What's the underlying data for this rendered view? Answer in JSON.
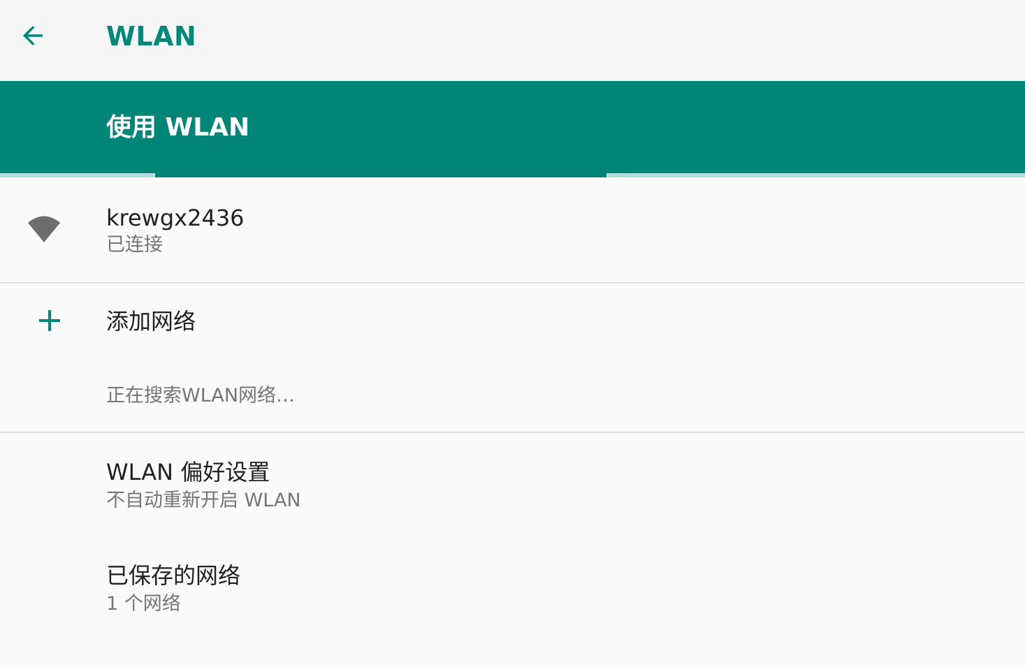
{
  "app_bar": {
    "back_icon": "arrow-back-icon",
    "title": "WLAN"
  },
  "wifi_switch": {
    "label": "使用 WLAN",
    "enabled": true,
    "scanning": true
  },
  "connected_network": {
    "icon": "wifi-signal-icon",
    "ssid": "krewgx2436",
    "status": "已连接"
  },
  "add_network": {
    "icon": "plus-icon",
    "label": "添加网络"
  },
  "scan_status": "正在搜索WLAN网络…",
  "preferences": {
    "title": "WLAN 偏好设置",
    "summary": "不自动重新开启 WLAN"
  },
  "saved_networks": {
    "title": "已保存的网络",
    "summary": "1 个网络"
  },
  "colors": {
    "accent": "#008577",
    "title_teal": "#00897b",
    "progress_track": "#b2dfdb",
    "primary_text": "#212121",
    "secondary_text": "#757575"
  }
}
